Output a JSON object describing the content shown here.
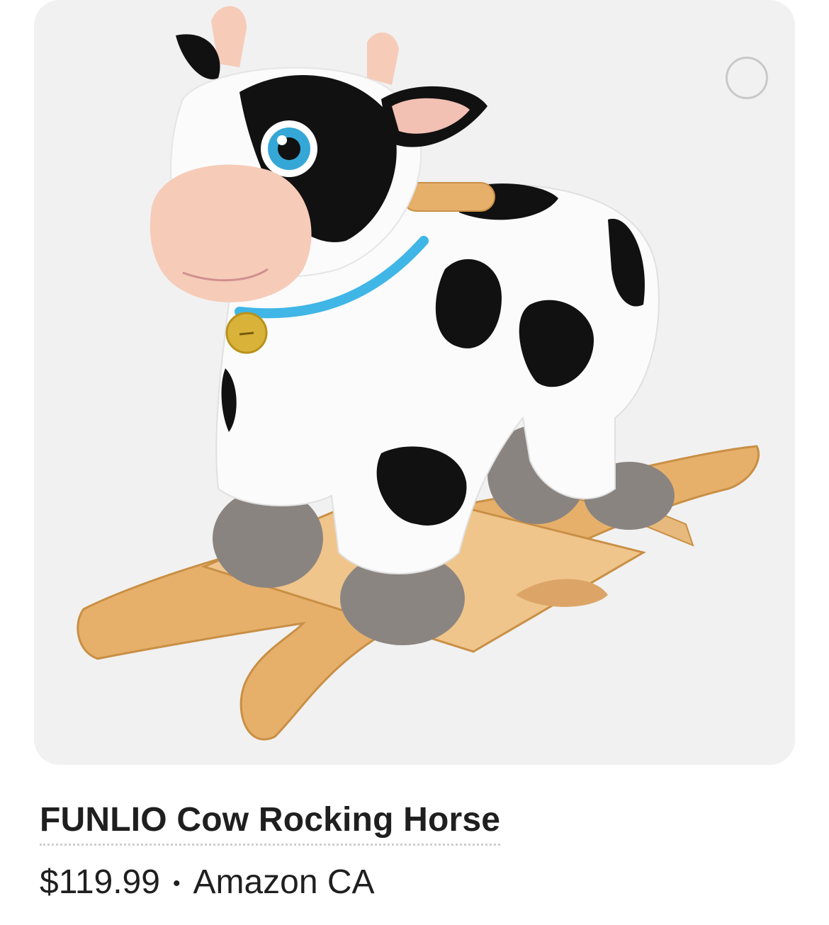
{
  "product": {
    "title": "FUNLIO Cow Rocking Horse",
    "price": "$119.99",
    "separator": "•",
    "store": "Amazon CA"
  },
  "colors": {
    "card_background": "#f1f1f1",
    "text": "#1f1f1f",
    "collar": "#3fb6e6",
    "wood": "#e7b877"
  },
  "icons": {
    "select": "circle-outline-icon"
  }
}
